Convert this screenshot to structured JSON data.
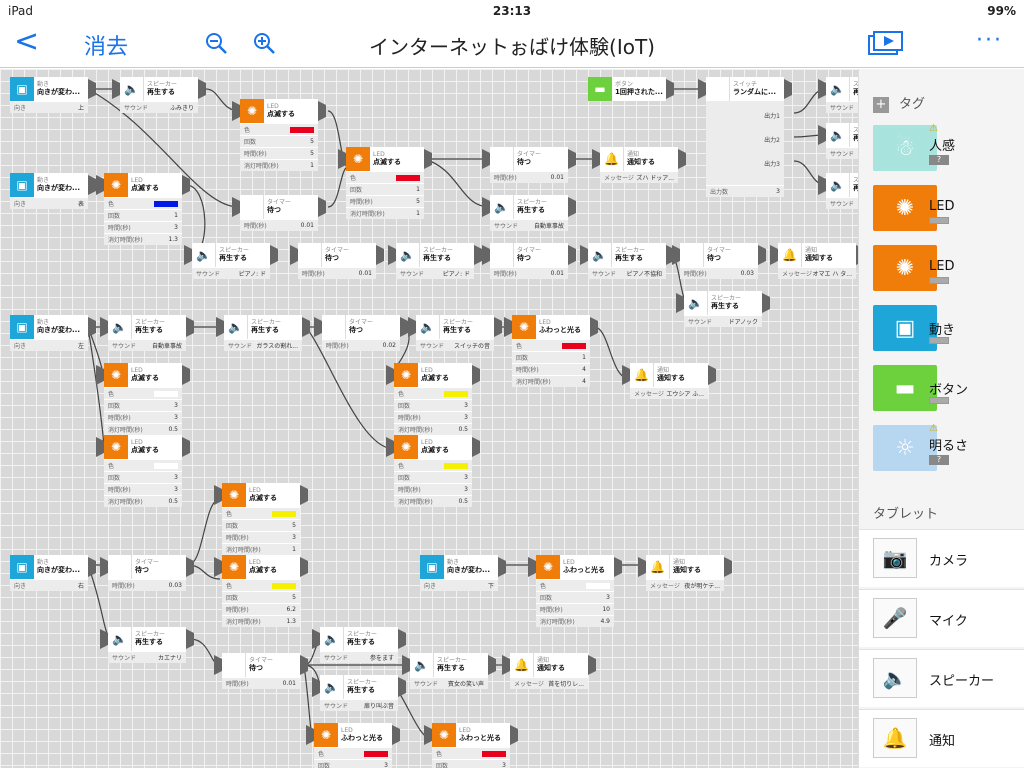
{
  "status": {
    "device": "iPad",
    "time": "23:13",
    "battery": "99%"
  },
  "toolbar": {
    "back": "<",
    "delete": "消去",
    "title": "インターネットぉばけ体験(IoT)",
    "more": "···"
  },
  "labels": {
    "speaker": "スピーカー",
    "play": "再生する",
    "sound": "サウンド",
    "led": "LED",
    "blink": "点滅する",
    "glow": "ふわっと光る",
    "color": "色",
    "count": "回数",
    "ontime": "時間(秒)",
    "offtime": "消灯時間(秒)",
    "timer": "タイマー",
    "wait": "待つ",
    "waittime": "時間(秒)",
    "notify": "通知",
    "notify_act": "通知する",
    "message": "メッセージ",
    "motion": "動き",
    "dirchange": "向きが変わ...",
    "dir": "向き",
    "button": "ボタン",
    "pressed": "1回押された...",
    "switch": "スイッチ",
    "random": "ランダムに...",
    "out1": "出力1",
    "out2": "出力2",
    "out3": "出力3",
    "outcount": "出力数"
  },
  "values": {
    "up": "上",
    "front": "表",
    "left": "左",
    "right": "右",
    "down": "下",
    "fumikiri": "ふみきり",
    "pianodo": "ピアノ: ド",
    "pianodo2": "ピアノ:ド",
    "pianofukyowa": "ピアノ不協和",
    "doanokku": "ドアノック",
    "jidousha": "自動車事故",
    "glass": "ガラスの割れ...",
    "switchsound": "スイッチの音",
    "camera_shutter": "カエナリ",
    "demasu": "参をます",
    "kyoukan": "賓女の笑い声",
    "hyoukai": "首を切りレ...",
    "kiri": "扉り叫ぶ音",
    "oshiri": "オマエ ハ タ...",
    "hanmu": "ズハ ドッア...",
    "sosa": "エウシア ふ...",
    "kouyou": "夜が明ケテ...",
    "t1": "0.01",
    "t2": "0.03",
    "t3": "0.02",
    "n1": "1",
    "n2": "2",
    "n3": "3",
    "n4": "4",
    "n5": "5",
    "n10": "10",
    "v05": "0.5",
    "v13": "1.3",
    "v12": "1.2",
    "v49": "4.9",
    "v62": "6.2"
  },
  "sidebar": {
    "tag_header": "タグ",
    "tags": [
      {
        "label": "人感",
        "color": "#a8e3dd",
        "warn": true
      },
      {
        "label": "LED",
        "color": "#f07d0a",
        "warn": false
      },
      {
        "label": "LED",
        "color": "#f07d0a",
        "warn": false
      },
      {
        "label": "動き",
        "color": "#1fa6d9",
        "warn": false
      },
      {
        "label": "ボタン",
        "color": "#6cd13d",
        "warn": false
      },
      {
        "label": "明るさ",
        "color": "#b7d6f0",
        "warn": true
      }
    ],
    "warn_mark": "⚠",
    "unknown": "?",
    "tablet_header": "タブレット",
    "tablet": [
      {
        "label": "カメラ",
        "icon": "camera-icon"
      },
      {
        "label": "マイク",
        "icon": "mic-icon"
      },
      {
        "label": "スピーカー",
        "icon": "speaker-icon"
      },
      {
        "label": "通知",
        "icon": "bell-icon"
      }
    ]
  },
  "colors": {
    "accent": "#1a73e8",
    "led": "#f07d0a",
    "motion": "#1fa6d9",
    "button": "#6cd13d",
    "red": "#e8001c",
    "blue": "#0018e8",
    "yellow": "#f5f000",
    "white": "#ffffff"
  }
}
